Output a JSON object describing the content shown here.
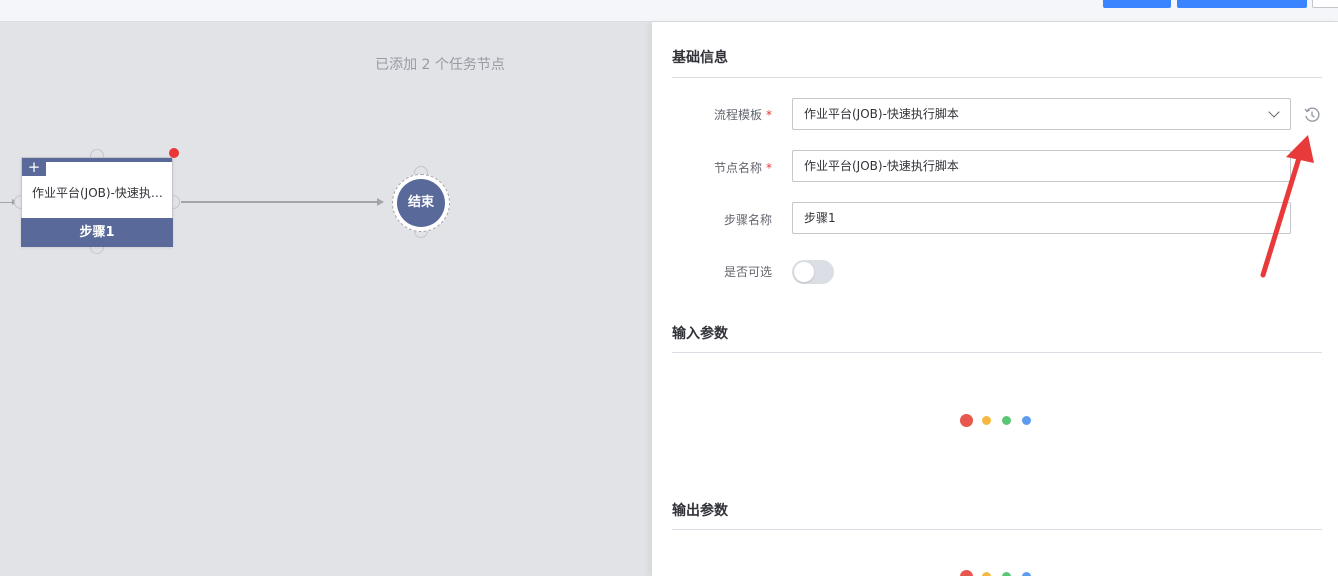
{
  "canvas": {
    "hint": "已添加 2 个任务节点",
    "task_node": {
      "name": "作业平台(JOB)-快速执行脚本",
      "step": "步骤1",
      "plus": "+"
    },
    "end_node": {
      "label": "结束"
    }
  },
  "panel": {
    "basic_info_title": "基础信息",
    "fields": {
      "template_label": "流程模板",
      "template_value": "作业平台(JOB)-快速执行脚本",
      "node_name_label": "节点名称",
      "node_name_value": "作业平台(JOB)-快速执行脚本",
      "step_name_label": "步骤名称",
      "step_name_value": "步骤1",
      "optional_label": "是否可选",
      "required_mark": "*"
    },
    "optional_toggle_on": false,
    "input_params_title": "输入参数",
    "output_params_title": "输出参数"
  },
  "colors": {
    "primary": "#3a84ff",
    "node": "#596a9a",
    "required": "#ea3636",
    "annotation_arrow": "#e83a3a",
    "loading_dots": [
      "#e8574d",
      "#f5b940",
      "#5bc776",
      "#5b9cf0"
    ]
  },
  "icons": {
    "template_history": "history-clock-icon",
    "dropdown": "chevron-down-icon"
  }
}
